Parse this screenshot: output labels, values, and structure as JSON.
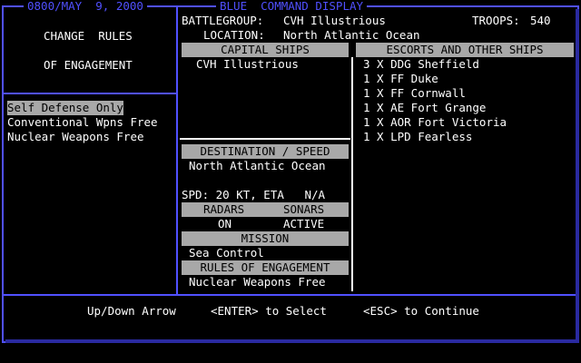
{
  "header": {
    "date": "0800/MAY  9, 2000",
    "title": "BLUE  COMMAND DISPLAY"
  },
  "left_panel": {
    "heading_line1": "CHANGE  RULES",
    "heading_line2": "OF ENGAGEMENT",
    "options": [
      "Self Defense Only",
      "Conventional Wpns Free",
      "Nuclear Weapons Free"
    ],
    "selected_index": 0
  },
  "battlegroup": {
    "label": "BATTLEGROUP:",
    "name": "CVH Illustrious",
    "troops_label": "TROOPS:",
    "troops": "540",
    "location_label": "LOCATION:",
    "location": "North Atlantic Ocean"
  },
  "capital_ships": {
    "header": "CAPITAL SHIPS",
    "items": [
      "CVH Illustrious"
    ]
  },
  "escorts": {
    "header": "ESCORTS AND OTHER SHIPS",
    "items": [
      "3 X DDG Sheffield",
      "1 X FF Duke",
      "1 X FF Cornwall",
      "1 X AE Fort Grange",
      "1 X AOR Fort Victoria",
      "1 X LPD Fearless"
    ]
  },
  "destination": {
    "header": "DESTINATION / SPEED",
    "value": "North Atlantic Ocean",
    "speed_line": "SPD: 20 KT, ETA   N/A"
  },
  "sensors": {
    "radars_header": "RADARS",
    "sonars_header": "SONARS",
    "radars_value": "ON",
    "sonars_value": "ACTIVE"
  },
  "mission": {
    "header": "MISSION",
    "value": "Sea Control"
  },
  "roe": {
    "header": "RULES OF ENGAGEMENT",
    "value": "Nuclear Weapons Free"
  },
  "footer": {
    "nav": "Up/Down Arrow",
    "enter": "<ENTER> to Select",
    "esc": "<ESC> to Continue"
  },
  "colors": {
    "frame": "#5050ff",
    "bar": "#a8a8a8",
    "text": "#ffffff"
  }
}
